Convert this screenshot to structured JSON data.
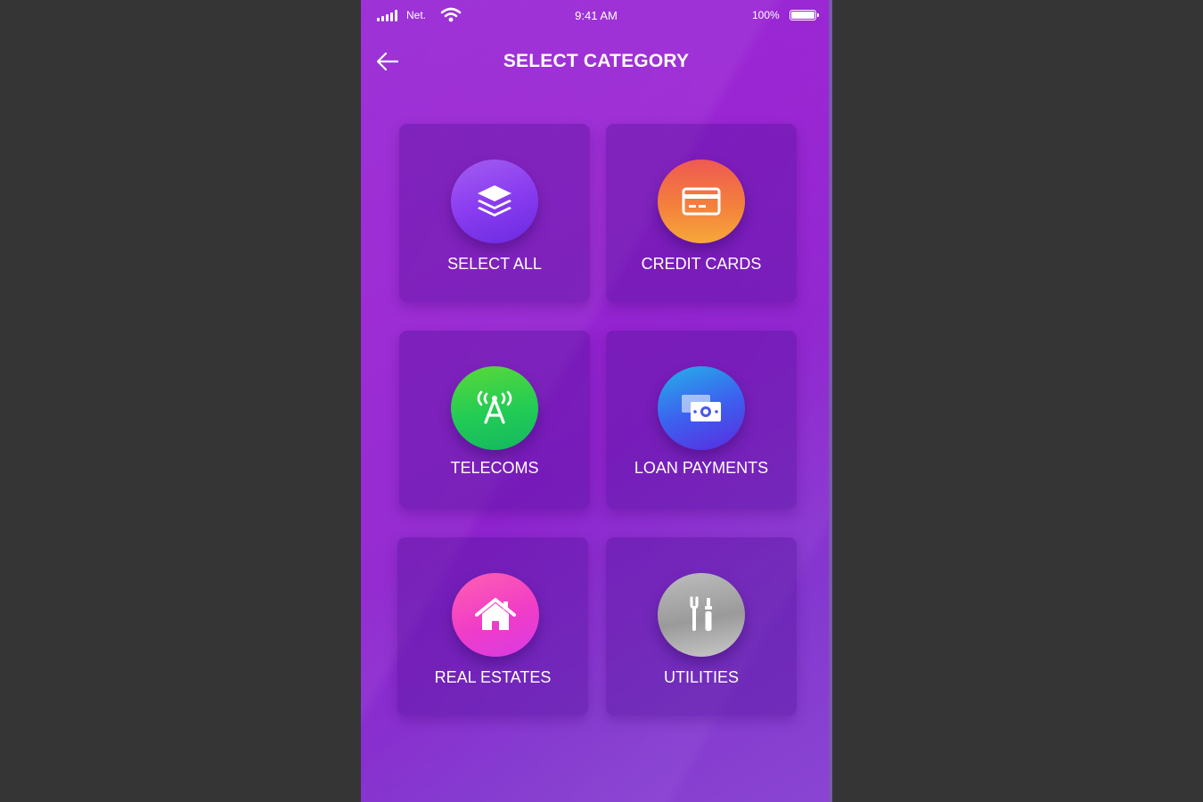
{
  "status_bar": {
    "carrier": "Net.",
    "time": "9:41 AM",
    "battery": "100%"
  },
  "header": {
    "title": "SELECT CATEGORY",
    "back_icon": "arrow-left-icon"
  },
  "categories": [
    {
      "label": "SELECT ALL",
      "icon": "layers-icon",
      "color": "#8a3cf0"
    },
    {
      "label": "CREDIT CARDS",
      "icon": "credit-card-icon",
      "color": "#f3803c"
    },
    {
      "label": "TELECOMS",
      "icon": "antenna-icon",
      "color": "#22cc55"
    },
    {
      "label": "LOAN PAYMENTS",
      "icon": "money-icon",
      "color": "#3b63ef"
    },
    {
      "label": "REAL ESTATES",
      "icon": "house-icon",
      "color": "#f03dc8"
    },
    {
      "label": "UTILITIES",
      "icon": "tools-icon",
      "color": "#9a9a9a"
    }
  ],
  "colors": {
    "background": "#9a25d3",
    "outer_background": "#353535"
  }
}
